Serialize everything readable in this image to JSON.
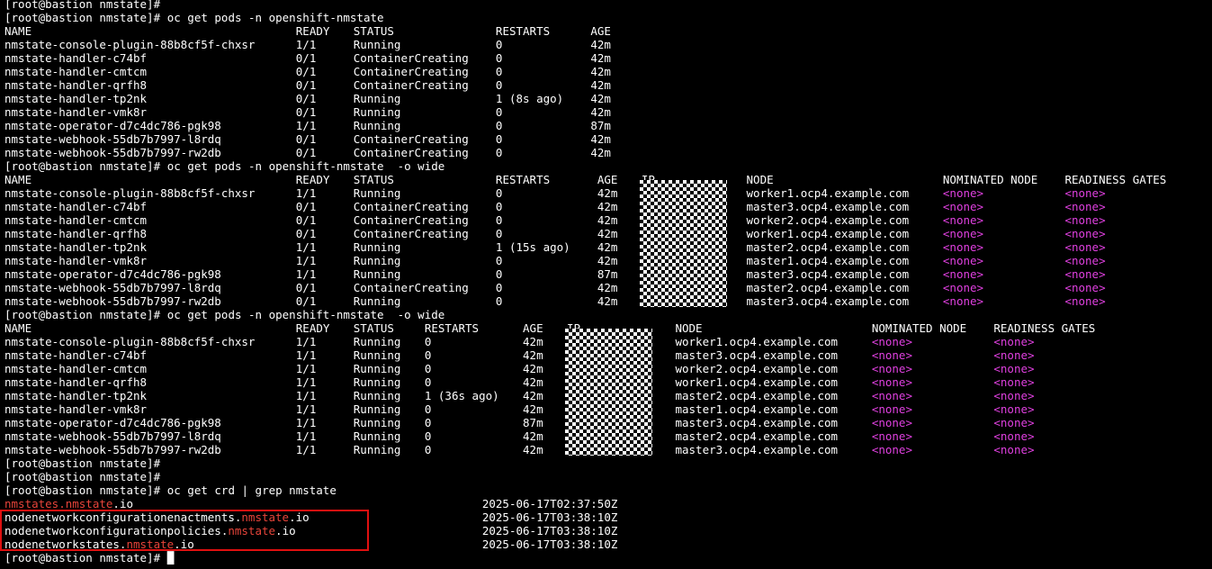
{
  "prompt": "[root@bastion nmstate]#",
  "commands": {
    "get_pods": "oc get pods -n openshift-nmstate",
    "get_pods_wide": "oc get pods -n openshift-nmstate  -o wide",
    "get_crd": "oc get crd | grep nmstate"
  },
  "headers": {
    "name": "NAME",
    "ready": "READY",
    "status": "STATUS",
    "restarts": "RESTARTS",
    "age": "AGE",
    "ip": "IP",
    "node": "NODE",
    "nominated_node": "NOMINATED NODE",
    "readiness_gates": "READINESS GATES"
  },
  "none_value": "<none>",
  "colors": {
    "highlight": "#e040e0",
    "crd_suffix": "#e8443a",
    "annotation_box": "#e01010"
  },
  "table1": [
    {
      "name": "nmstate-console-plugin-88b8cf5f-chxsr",
      "ready": "1/1",
      "status": "Running",
      "restarts": "0",
      "age": "42m"
    },
    {
      "name": "nmstate-handler-c74bf",
      "ready": "0/1",
      "status": "ContainerCreating",
      "restarts": "0",
      "age": "42m"
    },
    {
      "name": "nmstate-handler-cmtcm",
      "ready": "0/1",
      "status": "ContainerCreating",
      "restarts": "0",
      "age": "42m"
    },
    {
      "name": "nmstate-handler-qrfh8",
      "ready": "0/1",
      "status": "ContainerCreating",
      "restarts": "0",
      "age": "42m"
    },
    {
      "name": "nmstate-handler-tp2nk",
      "ready": "0/1",
      "status": "Running",
      "restarts": "1 (8s ago)",
      "age": "42m"
    },
    {
      "name": "nmstate-handler-vmk8r",
      "ready": "0/1",
      "status": "Running",
      "restarts": "0",
      "age": "42m"
    },
    {
      "name": "nmstate-operator-d7c4dc786-pgk98",
      "ready": "1/1",
      "status": "Running",
      "restarts": "0",
      "age": "87m"
    },
    {
      "name": "nmstate-webhook-55db7b7997-l8rdq",
      "ready": "0/1",
      "status": "ContainerCreating",
      "restarts": "0",
      "age": "42m"
    },
    {
      "name": "nmstate-webhook-55db7b7997-rw2db",
      "ready": "0/1",
      "status": "ContainerCreating",
      "restarts": "0",
      "age": "42m"
    }
  ],
  "table2": [
    {
      "name": "nmstate-console-plugin-88b8cf5f-chxsr",
      "ready": "1/1",
      "status": "Running",
      "restarts": "0",
      "age": "42m",
      "node": "worker1.ocp4.example.com"
    },
    {
      "name": "nmstate-handler-c74bf",
      "ready": "0/1",
      "status": "ContainerCreating",
      "restarts": "0",
      "age": "42m",
      "node": "master3.ocp4.example.com"
    },
    {
      "name": "nmstate-handler-cmtcm",
      "ready": "0/1",
      "status": "ContainerCreating",
      "restarts": "0",
      "age": "42m",
      "node": "worker2.ocp4.example.com"
    },
    {
      "name": "nmstate-handler-qrfh8",
      "ready": "0/1",
      "status": "ContainerCreating",
      "restarts": "0",
      "age": "42m",
      "node": "worker1.ocp4.example.com"
    },
    {
      "name": "nmstate-handler-tp2nk",
      "ready": "1/1",
      "status": "Running",
      "restarts": "1 (15s ago)",
      "age": "42m",
      "node": "master2.ocp4.example.com"
    },
    {
      "name": "nmstate-handler-vmk8r",
      "ready": "1/1",
      "status": "Running",
      "restarts": "0",
      "age": "42m",
      "node": "master1.ocp4.example.com"
    },
    {
      "name": "nmstate-operator-d7c4dc786-pgk98",
      "ready": "1/1",
      "status": "Running",
      "restarts": "0",
      "age": "87m",
      "node": "master3.ocp4.example.com"
    },
    {
      "name": "nmstate-webhook-55db7b7997-l8rdq",
      "ready": "0/1",
      "status": "ContainerCreating",
      "restarts": "0",
      "age": "42m",
      "node": "master2.ocp4.example.com"
    },
    {
      "name": "nmstate-webhook-55db7b7997-rw2db",
      "ready": "0/1",
      "status": "Running",
      "restarts": "0",
      "age": "42m",
      "node": "master3.ocp4.example.com"
    }
  ],
  "table3": [
    {
      "name": "nmstate-console-plugin-88b8cf5f-chxsr",
      "ready": "1/1",
      "status": "Running",
      "restarts": "0",
      "age": "42m",
      "node": "worker1.ocp4.example.com"
    },
    {
      "name": "nmstate-handler-c74bf",
      "ready": "1/1",
      "status": "Running",
      "restarts": "0",
      "age": "42m",
      "node": "master3.ocp4.example.com"
    },
    {
      "name": "nmstate-handler-cmtcm",
      "ready": "1/1",
      "status": "Running",
      "restarts": "0",
      "age": "42m",
      "node": "worker2.ocp4.example.com"
    },
    {
      "name": "nmstate-handler-qrfh8",
      "ready": "1/1",
      "status": "Running",
      "restarts": "0",
      "age": "42m",
      "node": "worker1.ocp4.example.com"
    },
    {
      "name": "nmstate-handler-tp2nk",
      "ready": "1/1",
      "status": "Running",
      "restarts": "1 (36s ago)",
      "age": "42m",
      "node": "master2.ocp4.example.com"
    },
    {
      "name": "nmstate-handler-vmk8r",
      "ready": "1/1",
      "status": "Running",
      "restarts": "0",
      "age": "42m",
      "node": "master1.ocp4.example.com"
    },
    {
      "name": "nmstate-operator-d7c4dc786-pgk98",
      "ready": "1/1",
      "status": "Running",
      "restarts": "0",
      "age": "87m",
      "node": "master3.ocp4.example.com"
    },
    {
      "name": "nmstate-webhook-55db7b7997-l8rdq",
      "ready": "1/1",
      "status": "Running",
      "restarts": "0",
      "age": "42m",
      "node": "master2.ocp4.example.com"
    },
    {
      "name": "nmstate-webhook-55db7b7997-rw2db",
      "ready": "1/1",
      "status": "Running",
      "restarts": "0",
      "age": "42m",
      "node": "master3.ocp4.example.com"
    }
  ],
  "crds": [
    {
      "prefix": "nmstates.",
      "suffix": "nmstate",
      "tail": ".io",
      "created": "2025-06-17T02:37:50Z"
    },
    {
      "prefix": "nodenetworkconfigurationenactments.",
      "suffix": "nmstate",
      "tail": ".io",
      "created": "2025-06-17T03:38:10Z"
    },
    {
      "prefix": "nodenetworkconfigurationpolicies.",
      "suffix": "nmstate",
      "tail": ".io",
      "created": "2025-06-17T03:38:10Z"
    },
    {
      "prefix": "nodenetworkstates.",
      "suffix": "nmstate",
      "tail": ".io",
      "created": "2025-06-17T03:38:10Z"
    }
  ]
}
